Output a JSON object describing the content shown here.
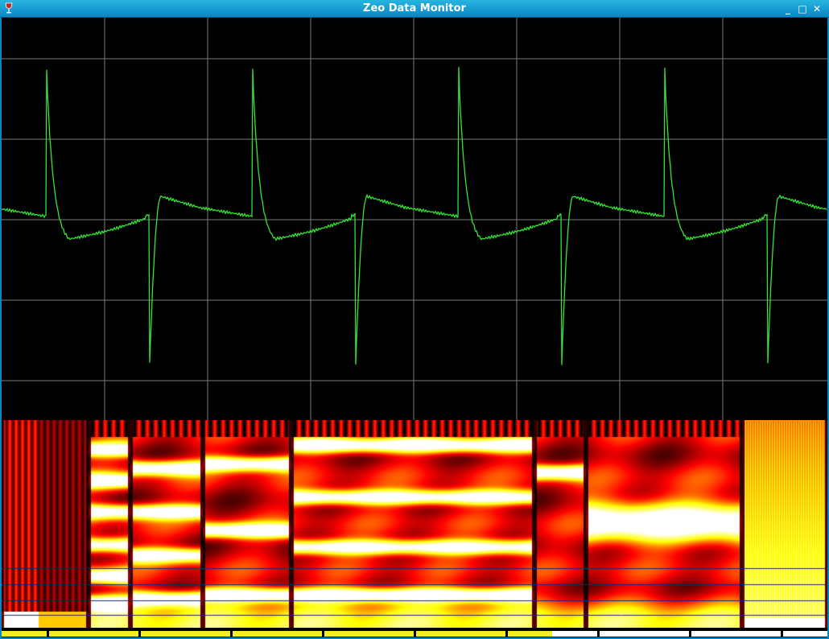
{
  "window": {
    "title": "Zeo Data Monitor",
    "minimize_glyph": "_",
    "maximize_glyph": "□",
    "close_glyph": "✕",
    "icon": "wine-glass-icon"
  },
  "colors": {
    "titlebar": "#0a86c4",
    "trace": "#33e633",
    "grid": "#7a7a7a",
    "timeline_yellow": "#f2ee1e",
    "timeline_white": "#ffffff"
  },
  "waveform": {
    "grid_columns": 8,
    "grid_rows": 5,
    "period_samples": 256,
    "baseline": 0.0,
    "events": [
      {
        "type": "positive_spike",
        "phase": 0.0
      },
      {
        "type": "negative_spike",
        "phase": 0.5
      }
    ],
    "cycles": 4
  },
  "spectrogram": {
    "segments": [
      {
        "bands": [
          0.97
        ],
        "style": "low"
      },
      {
        "bands": [
          0.14,
          0.29,
          0.44,
          0.6,
          0.75,
          0.88
        ],
        "style": "harmonic"
      },
      {
        "bands": [
          0.23,
          0.44,
          0.65,
          0.86
        ],
        "style": "harmonic"
      },
      {
        "bands": [
          0.21,
          0.53,
          0.84
        ],
        "style": "harmonic"
      },
      {
        "bands": [
          0.12,
          0.37,
          0.61,
          0.84
        ],
        "style": "harmonic"
      },
      {
        "bands": [
          0.25
        ],
        "style": "harmonic"
      },
      {
        "bands": [
          0.49
        ],
        "style": "wide"
      },
      {
        "bands": [],
        "style": "noise"
      }
    ]
  },
  "timeline": {
    "cells": [
      {
        "color": "yellow"
      },
      {
        "color": "yellow"
      },
      {
        "color": "yellow"
      },
      {
        "color": "yellow"
      },
      {
        "color": "yellow"
      },
      {
        "color": "yellow"
      },
      {
        "color": "white"
      },
      {
        "color": "white"
      },
      {
        "color": "white"
      }
    ]
  }
}
